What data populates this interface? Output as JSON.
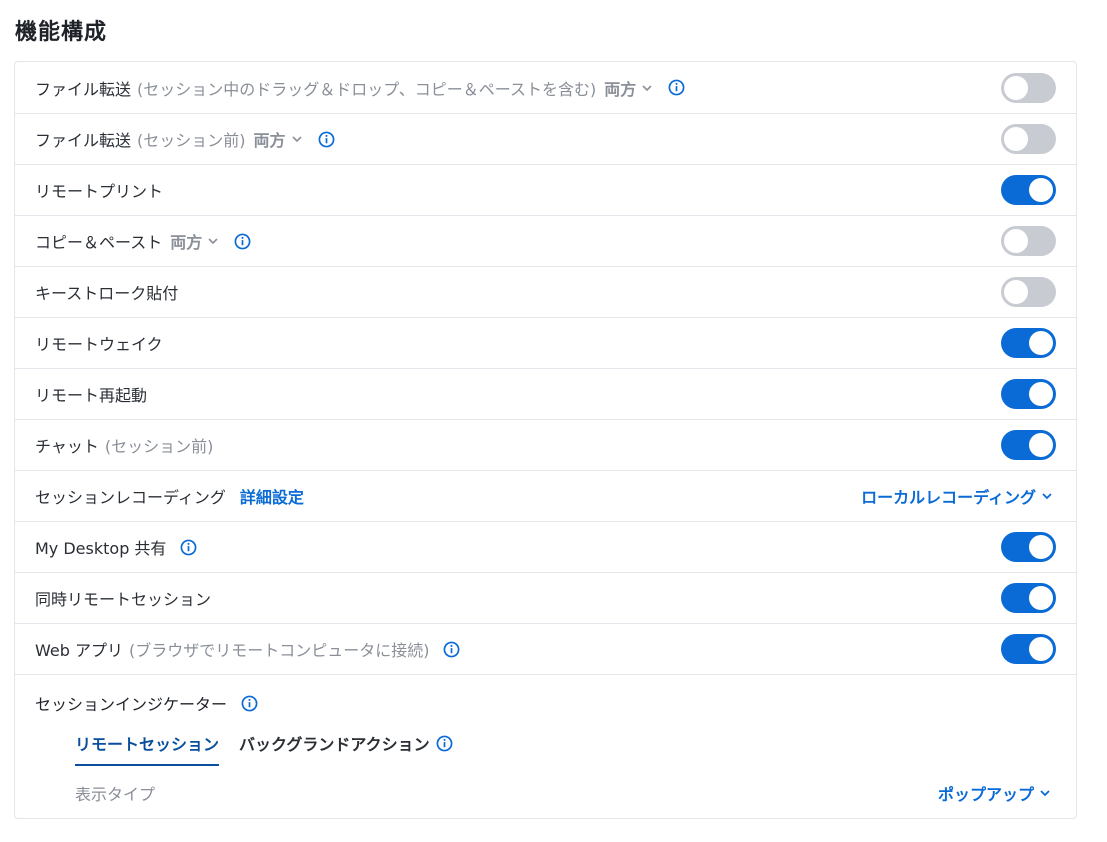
{
  "page_title": "機能構成",
  "colors": {
    "accent": "#0b6bd6",
    "toggle_off": "#c8ccd2",
    "muted": "#8a8f98"
  },
  "rows": [
    {
      "label": "ファイル転送",
      "note": "(セッション中のドラッグ＆ドロップ、コピー＆ペーストを含む)",
      "select": "両方",
      "info": true,
      "toggle": "off"
    },
    {
      "label": "ファイル転送",
      "note": "(セッション前)",
      "select": "両方",
      "info": true,
      "toggle": "off"
    },
    {
      "label": "リモートプリント",
      "toggle": "on"
    },
    {
      "label": "コピー＆ペースト",
      "select": "両方",
      "info": true,
      "toggle": "off"
    },
    {
      "label": "キーストローク貼付",
      "toggle": "off"
    },
    {
      "label": "リモートウェイク",
      "toggle": "on"
    },
    {
      "label": "リモート再起動",
      "toggle": "on"
    },
    {
      "label": "チャット",
      "note": "(セッション前)",
      "toggle": "on"
    },
    {
      "label": "セッションレコーディング",
      "link": "詳細設定",
      "right_select": "ローカルレコーディング"
    },
    {
      "label": "My Desktop 共有",
      "info": true,
      "toggle": "on"
    },
    {
      "label": "同時リモートセッション",
      "toggle": "on"
    },
    {
      "label": "Web アプリ",
      "note": "(ブラウザでリモートコンピュータに接続)",
      "info": true,
      "toggle": "on"
    }
  ],
  "session_indicator": {
    "label": "セッションインジケーター",
    "tabs": [
      {
        "label": "リモートセッション",
        "active": true
      },
      {
        "label": "バックグランドアクション",
        "active": false
      }
    ],
    "display_type_label": "表示タイプ",
    "display_type_value": "ポップアップ"
  }
}
